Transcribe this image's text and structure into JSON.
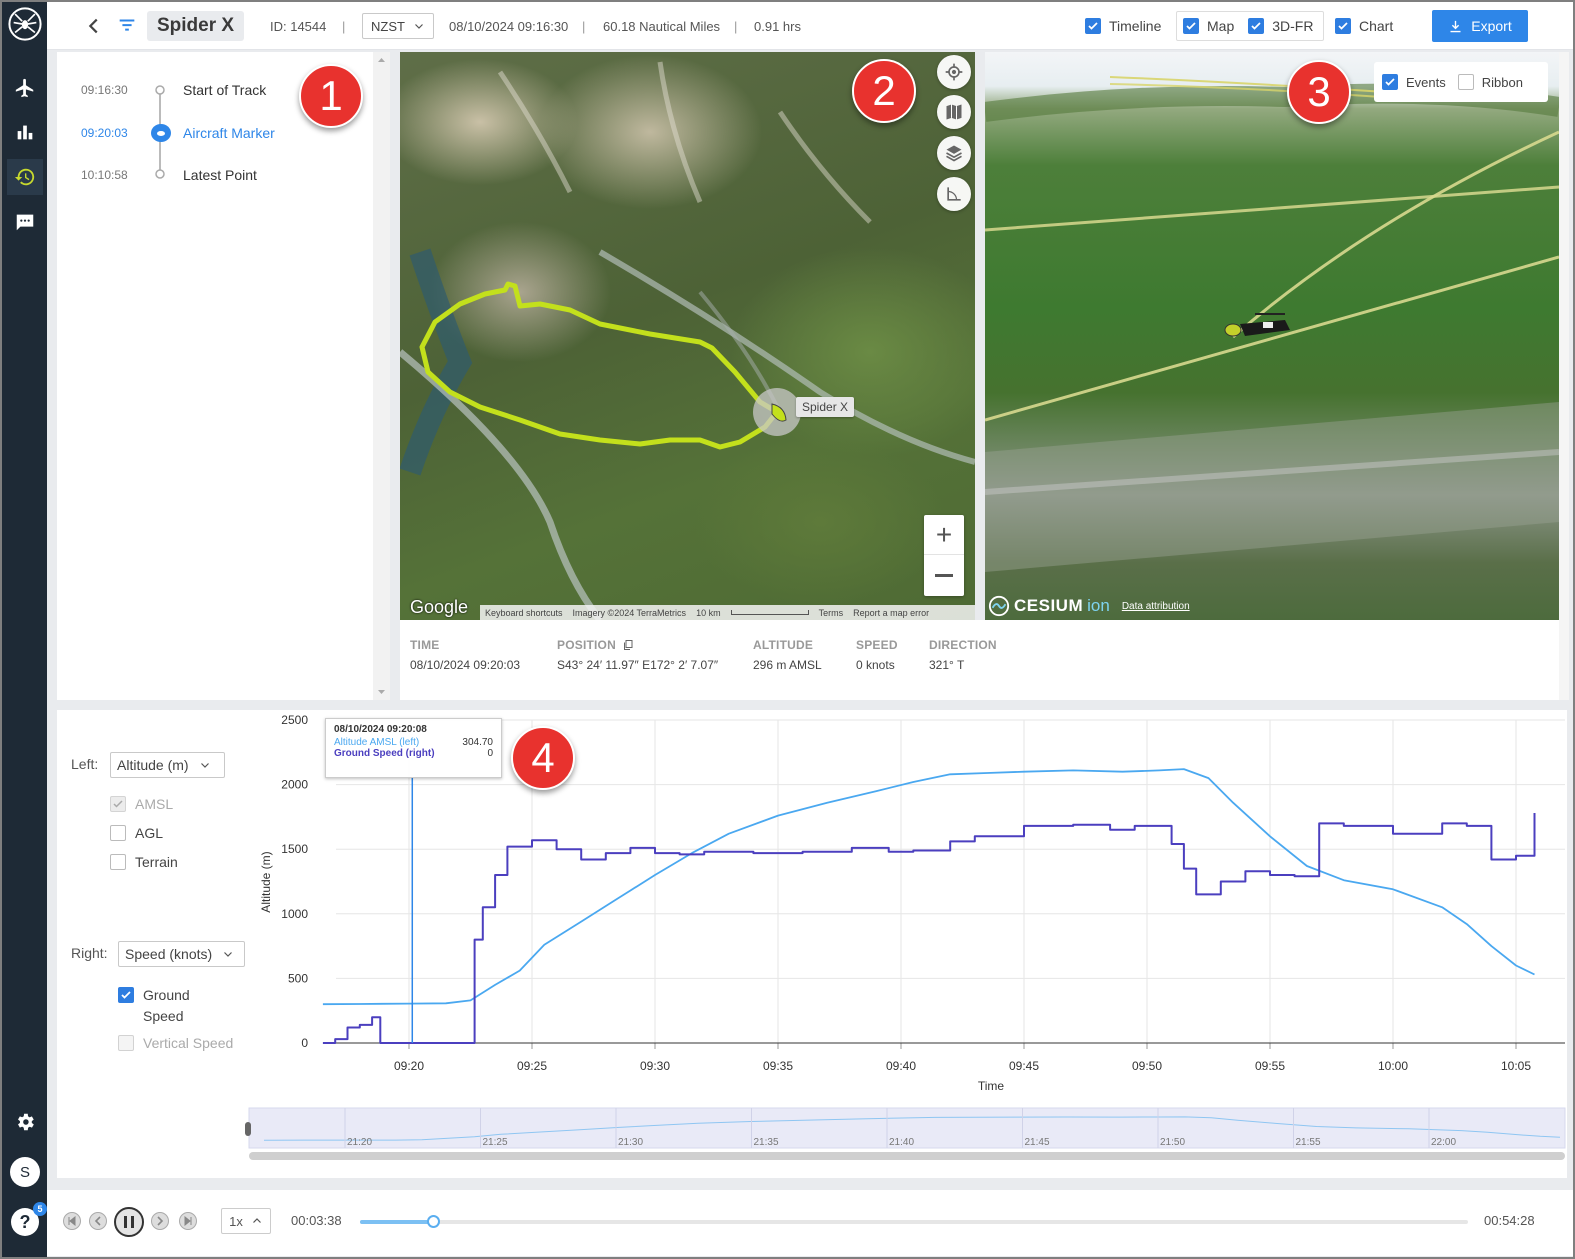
{
  "header": {
    "title": "Spider X",
    "id_text": "ID: 14544",
    "timezone": "NZST",
    "start_datetime": "08/10/2024 09:16:30",
    "distance": "60.18 Nautical Miles",
    "duration": "0.91 hrs",
    "toggles": {
      "timeline": "Timeline",
      "map": "Map",
      "fr3d": "3D-FR",
      "chart": "Chart"
    },
    "export_label": "Export"
  },
  "sidebar": {
    "icons": [
      "spider-logo-icon",
      "aircraft-icon",
      "bar-chart-icon",
      "history-icon",
      "message-icon",
      "gear-icon",
      "avatar",
      "help-icon"
    ],
    "avatar_letter": "S",
    "help_badge": "5"
  },
  "timeline": {
    "items": [
      {
        "time": "09:16:30",
        "label": "Start of Track"
      },
      {
        "time": "09:20:03",
        "label": "Aircraft Marker"
      },
      {
        "time": "10:10:58",
        "label": "Latest Point"
      }
    ]
  },
  "map2d": {
    "marker_label": "Spider X",
    "google_label": "Google",
    "footer": [
      "Keyboard shortcuts",
      "Imagery ©2024 TerraMetrics",
      "10 km",
      "Terms",
      "Report a map error"
    ]
  },
  "map3d": {
    "events_label": "Events",
    "ribbon_label": "Ribbon",
    "cesium_label": "CESIUM",
    "ion_label": "ion",
    "attribution": "Data attribution"
  },
  "info": {
    "time": {
      "label": "TIME",
      "value": "08/10/2024 09:20:03"
    },
    "position": {
      "label": "POSITION",
      "value": "S43° 24′ 11.97″ E172° 2′ 7.07″"
    },
    "altitude": {
      "label": "ALTITUDE",
      "value": "296 m AMSL"
    },
    "speed": {
      "label": "SPEED",
      "value": "0 knots"
    },
    "direction": {
      "label": "DIRECTION",
      "value": "321° T"
    }
  },
  "chart_controls": {
    "left_label": "Left:",
    "left_select": "Altitude (m)",
    "left_options": [
      {
        "label": "AMSL",
        "checked": true,
        "disabled": true
      },
      {
        "label": "AGL",
        "checked": false,
        "disabled": false
      },
      {
        "label": "Terrain",
        "checked": false,
        "disabled": false
      }
    ],
    "right_label": "Right:",
    "right_select": "Speed (knots)",
    "right_options": [
      {
        "label": "Ground Speed",
        "checked": true,
        "disabled": false
      },
      {
        "label": "Vertical Speed",
        "checked": false,
        "disabled": true
      }
    ]
  },
  "tooltip": {
    "title": "08/10/2024 09:20:08",
    "rows": [
      {
        "name": "Altitude AMSL (left)",
        "value": "304.70"
      },
      {
        "name": "Ground Speed (right)",
        "value": "0"
      }
    ]
  },
  "chart_data": {
    "type": "line",
    "xlabel": "Time",
    "ylabel": "Altitude (m)",
    "ylim": [
      0,
      2500
    ],
    "yticks": [
      "0",
      "500",
      "1000",
      "1500",
      "2000",
      "2500"
    ],
    "xticks": [
      "09:20",
      "09:25",
      "09:30",
      "09:35",
      "09:40",
      "09:45",
      "09:50",
      "09:55",
      "10:00",
      "10:05"
    ],
    "cursor_time": "09:20:08",
    "series": [
      {
        "name": "Altitude AMSL (left)",
        "color": "#4aa8f0",
        "x": [
          "09:16:30",
          "09:18:00",
          "09:20:00",
          "09:21:30",
          "09:22:30",
          "09:23:30",
          "09:24:30",
          "09:25:30",
          "09:27:00",
          "09:28:30",
          "09:30:00",
          "09:31:30",
          "09:33:00",
          "09:35:00",
          "09:37:00",
          "09:39:00",
          "09:40:30",
          "09:42:00",
          "09:43:30",
          "09:45:00",
          "09:47:00",
          "09:49:00",
          "09:50:30",
          "09:51:30",
          "09:52:30",
          "09:53:30",
          "09:55:00",
          "09:56:30",
          "09:58:00",
          "10:00:00",
          "10:02:00",
          "10:03:00",
          "10:04:00",
          "10:05:00",
          "10:05:45"
        ],
        "values": [
          300,
          302,
          305,
          307,
          330,
          450,
          560,
          760,
          940,
          1120,
          1300,
          1470,
          1620,
          1760,
          1860,
          1950,
          2020,
          2080,
          2090,
          2100,
          2110,
          2100,
          2110,
          2120,
          2050,
          1860,
          1600,
          1370,
          1260,
          1190,
          1050,
          920,
          750,
          600,
          530
        ]
      },
      {
        "name": "Ground Speed (right)",
        "color": "#4b3fbf",
        "x": [
          "09:16:30",
          "09:17:00",
          "09:17:30",
          "09:18:00",
          "09:18:30",
          "09:18:50",
          "09:20:00",
          "09:22:20",
          "09:22:40",
          "09:23:00",
          "09:23:30",
          "09:24:00",
          "09:25:00",
          "09:26:00",
          "09:27:00",
          "09:28:00",
          "09:29:00",
          "09:30:00",
          "09:31:00",
          "09:32:00",
          "09:34:00",
          "09:36:00",
          "09:38:00",
          "09:39:30",
          "09:40:30",
          "09:42:00",
          "09:43:00",
          "09:45:00",
          "09:47:00",
          "09:48:30",
          "09:49:30",
          "09:51:00",
          "09:51:30",
          "09:52:00",
          "09:53:00",
          "09:54:00",
          "09:55:00",
          "09:56:00",
          "09:57:00",
          "09:58:00",
          "10:00:00",
          "10:02:00",
          "10:03:00",
          "10:04:00",
          "10:05:00",
          "10:05:45"
        ],
        "values": [
          0,
          30,
          120,
          140,
          200,
          0,
          0,
          0,
          800,
          1050,
          1300,
          1520,
          1570,
          1500,
          1420,
          1470,
          1510,
          1470,
          1460,
          1480,
          1470,
          1480,
          1510,
          1480,
          1490,
          1560,
          1600,
          1680,
          1690,
          1650,
          1680,
          1540,
          1350,
          1150,
          1250,
          1330,
          1300,
          1290,
          1700,
          1680,
          1620,
          1700,
          1680,
          1420,
          1450,
          1780
        ]
      }
    ]
  },
  "navigator": {
    "ticks": [
      "21:20",
      "21:25",
      "21:30",
      "21:35",
      "21:40",
      "21:45",
      "21:50",
      "21:55",
      "22:00"
    ]
  },
  "player": {
    "speed": "1x",
    "elapsed": "00:03:38",
    "total": "00:54:28",
    "progress": 0.066
  },
  "callouts": [
    "1",
    "2",
    "3",
    "4"
  ],
  "colors": {
    "accent": "#2e86e8",
    "sidebar": "#1e2a36",
    "track": "#c3e01c",
    "callout": "#e8322e"
  }
}
